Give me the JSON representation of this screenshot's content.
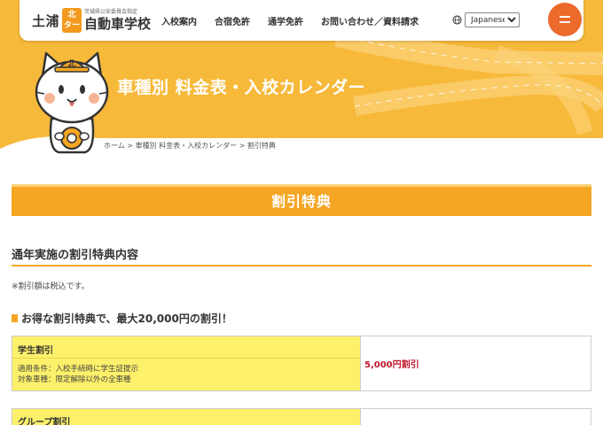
{
  "header": {
    "logo": {
      "part1": "土浦",
      "badge_top": "北",
      "badge_bottom": "ター",
      "small_text": "茨城県公安委員会指定",
      "part2": "自動車学校"
    },
    "nav": [
      "入校案内",
      "合宿免許",
      "通学免許",
      "お問い合わせ／資料請求"
    ],
    "language": {
      "selected": "Japanese"
    }
  },
  "hero": {
    "title": "車種別 料金表・入校カレンダー",
    "mascot_badge": "北",
    "breadcrumb": {
      "home": "ホーム",
      "sep": " > ",
      "parent": "車種別 料金表・入校カレンダー",
      "current": "割引特典"
    }
  },
  "page_title": "割引特典",
  "section_title": "通年実施の割引特典内容",
  "note": "※割引額は税込です。",
  "promo_heading": "お得な割引特典で、最大20,000円の割引！",
  "discounts": [
    {
      "name": "学生割引",
      "condition": "適用条件：入校手続時に学生証提示",
      "vehicle": "対象車種：限定解除以外の全車種",
      "amount": "5,000円割引"
    },
    {
      "name": "グループ割引"
    }
  ],
  "colors": {
    "hero_orange": "#f7b93a",
    "accent_orange": "#f5a623",
    "menu_orange": "#ec6a2b",
    "table_yellow": "#fdf06a",
    "price_red": "#c0182d"
  }
}
